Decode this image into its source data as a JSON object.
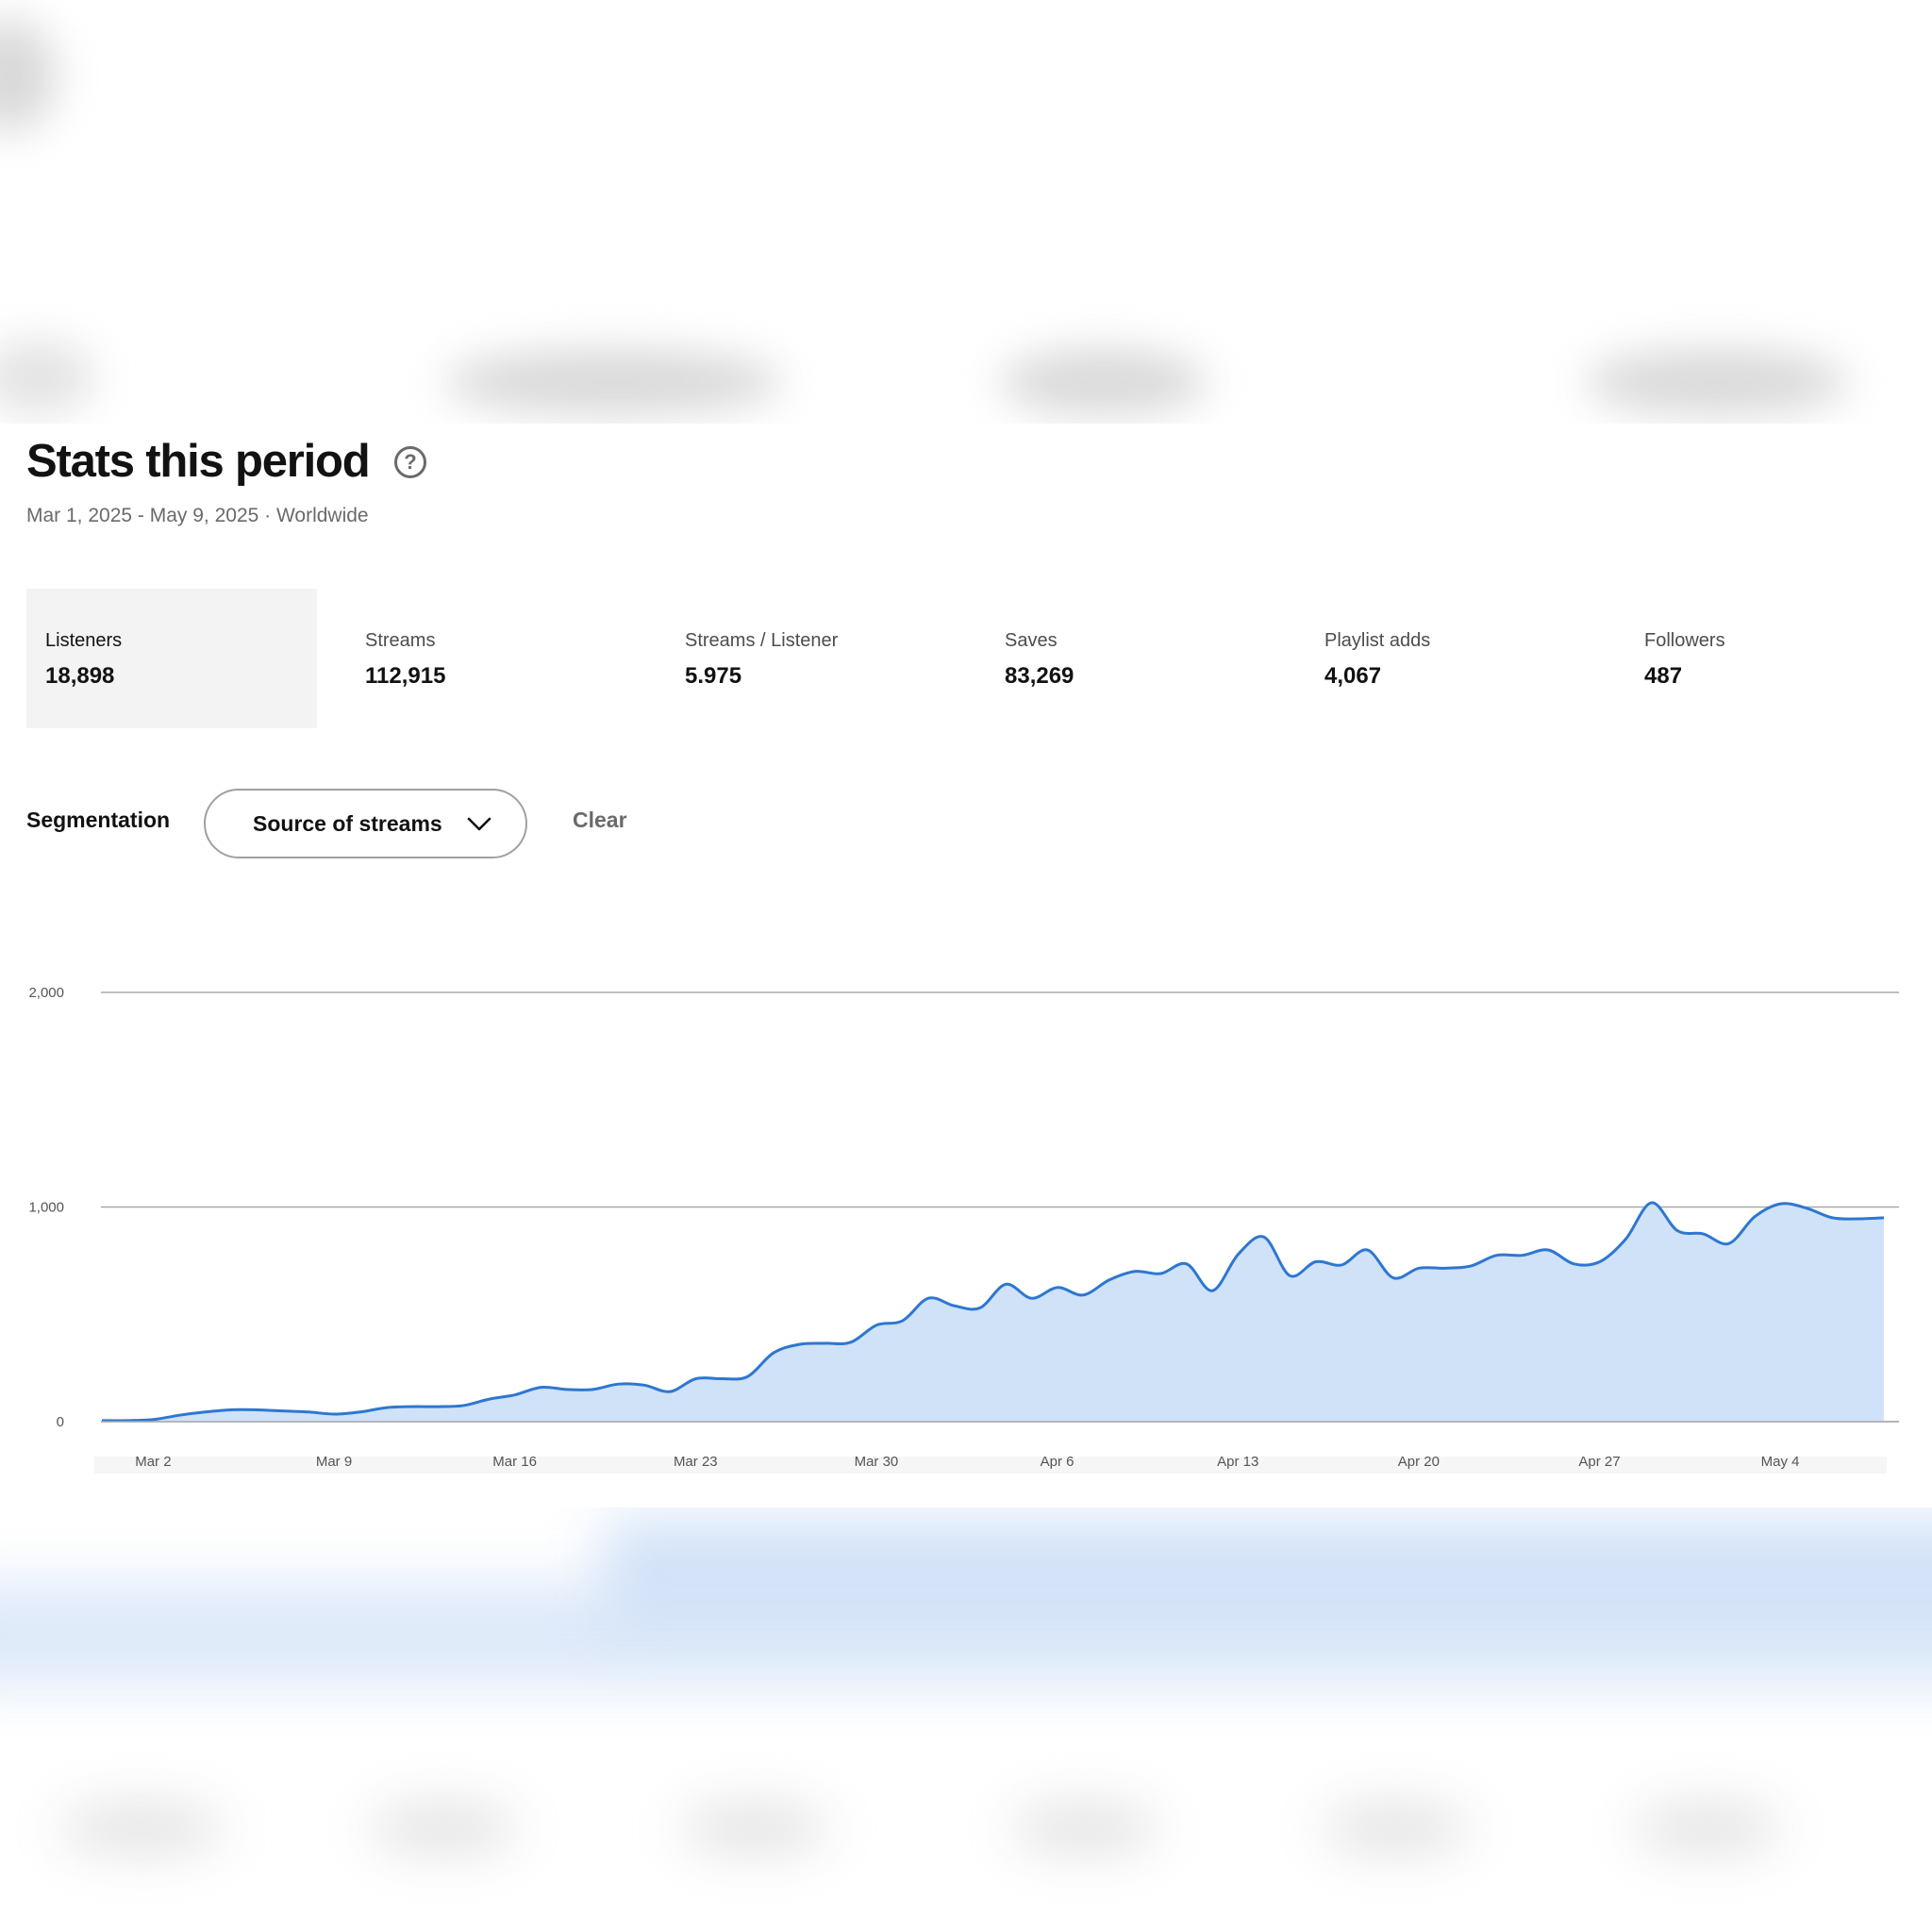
{
  "header": {
    "title": "Stats this period",
    "subtitle": "Mar 1, 2025 - May 9, 2025 · Worldwide",
    "help_icon": "question-circle-icon"
  },
  "metrics": [
    {
      "label": "Listeners",
      "value": "18,898",
      "active": true
    },
    {
      "label": "Streams",
      "value": "112,915",
      "active": false
    },
    {
      "label": "Streams / Listener",
      "value": "5.975",
      "active": false
    },
    {
      "label": "Saves",
      "value": "83,269",
      "active": false
    },
    {
      "label": "Playlist adds",
      "value": "4,067",
      "active": false
    },
    {
      "label": "Followers",
      "value": "487",
      "active": false
    }
  ],
  "segmentation": {
    "label": "Segmentation",
    "selected": "Source of streams",
    "clear_label": "Clear",
    "dropdown_icon": "chevron-down-icon"
  },
  "colors": {
    "line": "#2e77d0",
    "fill": "#d0e2f8",
    "grid": "#a9a9a9",
    "active_card": "#f3f3f3"
  },
  "chart_data": {
    "type": "area",
    "y_ticks": [
      "0",
      "1,000",
      "2,000"
    ],
    "ylim": [
      0,
      2000
    ],
    "x_ticks": [
      "Mar 2",
      "Mar 9",
      "Mar 16",
      "Mar 23",
      "Mar 30",
      "Apr 6",
      "Apr 13",
      "Apr 20",
      "Apr 27",
      "May 4"
    ],
    "x": [
      "2025-03-01",
      "2025-03-02",
      "2025-03-03",
      "2025-03-04",
      "2025-03-05",
      "2025-03-06",
      "2025-03-07",
      "2025-03-08",
      "2025-03-09",
      "2025-03-10",
      "2025-03-11",
      "2025-03-12",
      "2025-03-13",
      "2025-03-14",
      "2025-03-15",
      "2025-03-16",
      "2025-03-17",
      "2025-03-18",
      "2025-03-19",
      "2025-03-20",
      "2025-03-21",
      "2025-03-22",
      "2025-03-23",
      "2025-03-24",
      "2025-03-25",
      "2025-03-26",
      "2025-03-27",
      "2025-03-28",
      "2025-03-29",
      "2025-03-30",
      "2025-03-31",
      "2025-04-01",
      "2025-04-02",
      "2025-04-03",
      "2025-04-04",
      "2025-04-05",
      "2025-04-06",
      "2025-04-07",
      "2025-04-08",
      "2025-04-09",
      "2025-04-10",
      "2025-04-11",
      "2025-04-12",
      "2025-04-13",
      "2025-04-14",
      "2025-04-15",
      "2025-04-16",
      "2025-04-17",
      "2025-04-18",
      "2025-04-19",
      "2025-04-20",
      "2025-04-21",
      "2025-04-22",
      "2025-04-23",
      "2025-04-24",
      "2025-04-25",
      "2025-04-26",
      "2025-04-27",
      "2025-04-28",
      "2025-04-29",
      "2025-04-30",
      "2025-05-01",
      "2025-05-02",
      "2025-05-03",
      "2025-05-04",
      "2025-05-05",
      "2025-05-06",
      "2025-05-07",
      "2025-05-08",
      "2025-05-09"
    ],
    "values": [
      5,
      5,
      10,
      30,
      45,
      55,
      55,
      50,
      45,
      35,
      45,
      65,
      70,
      70,
      75,
      105,
      125,
      160,
      150,
      150,
      175,
      170,
      140,
      200,
      200,
      210,
      320,
      360,
      365,
      370,
      450,
      470,
      575,
      540,
      530,
      640,
      575,
      625,
      590,
      660,
      700,
      690,
      735,
      610,
      780,
      860,
      680,
      745,
      730,
      800,
      670,
      715,
      715,
      725,
      775,
      775,
      800,
      735,
      745,
      850,
      1020,
      890,
      875,
      830,
      955,
      1015,
      995,
      950,
      945,
      950
    ]
  }
}
